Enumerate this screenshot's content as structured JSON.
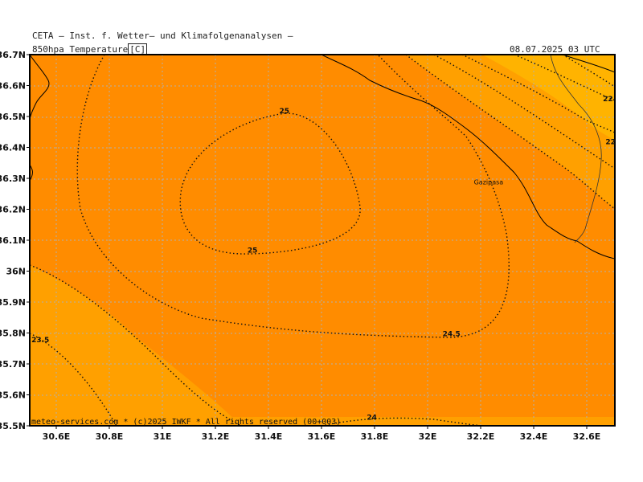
{
  "header": {
    "title": "CETA — Inst. f. Wetter— und Klimafolgenanalysen —",
    "parameter_prefix": "850hpa_Temperature",
    "unit": "C",
    "valid_time": "08.07.2025 03 UTC"
  },
  "map": {
    "lat_labels": [
      "36.7N",
      "36.6N",
      "36.5N",
      "36.4N",
      "36.3N",
      "36.2N",
      "36.1N",
      "36N",
      "35.9N",
      "35.8N",
      "35.7N",
      "35.6N",
      "35.5N"
    ],
    "lon_labels": [
      "30.6E",
      "30.8E",
      "31E",
      "31.2E",
      "31.4E",
      "31.6E",
      "31.8E",
      "32E",
      "32.2E",
      "32.4E",
      "32.6E"
    ],
    "place_names": [
      {
        "name": "Gazipasa",
        "lon": 32.23,
        "lat": 36.28
      }
    ],
    "contour_labels": [
      {
        "text": "25",
        "lon": 31.46,
        "lat": 36.51
      },
      {
        "text": "25",
        "lon": 31.34,
        "lat": 36.06
      },
      {
        "text": "24.5",
        "lon": 32.09,
        "lat": 35.79
      },
      {
        "text": "23.5",
        "lon": 30.54,
        "lat": 35.77
      },
      {
        "text": "24",
        "lon": 31.79,
        "lat": 35.52
      },
      {
        "text": "22",
        "lon": 32.68,
        "lat": 36.55
      },
      {
        "text": "22",
        "lon": 32.69,
        "lat": 36.41
      }
    ],
    "fill_colors": {
      "band_24_25": "#ff8c00",
      "band_23_24": "#ffa000",
      "band_22_23": "#ffb300",
      "coast": "#000000",
      "grid": "#b0b0b0"
    },
    "copyright": "meteo-services.com * (c)2025 IWKF * All rights reserved (00+003)"
  }
}
